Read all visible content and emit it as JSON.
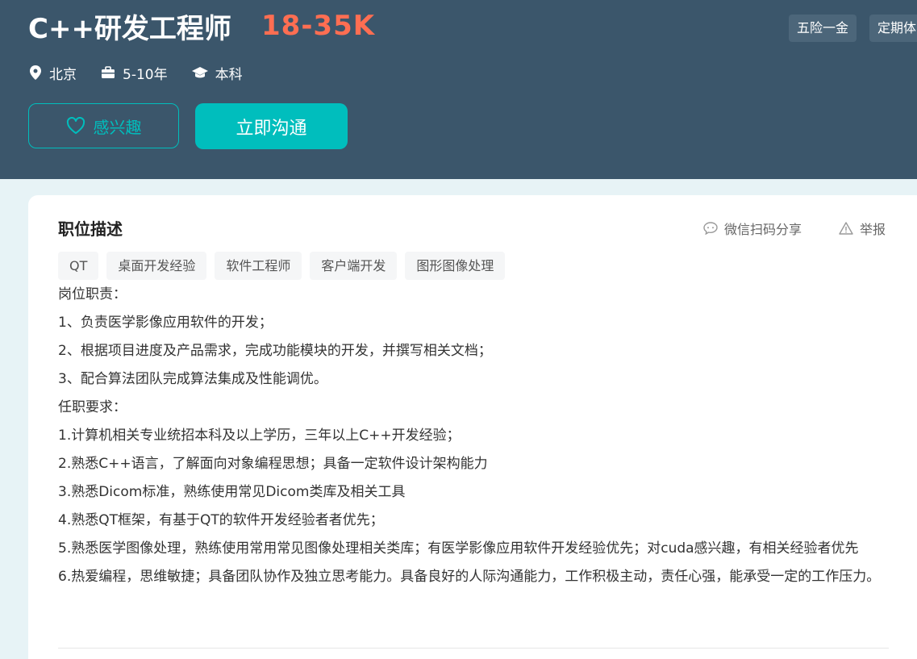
{
  "header": {
    "title": "C++研发工程师",
    "salary": "18-35K",
    "welfare": [
      "五险一金",
      "定期体"
    ],
    "meta": {
      "location": "北京",
      "experience": "5-10年",
      "degree": "本科"
    },
    "buttons": {
      "interest": "感兴趣",
      "chat": "立即沟通"
    }
  },
  "description": {
    "title": "职位描述",
    "share_label": "微信扫码分享",
    "report_label": "举报",
    "tags": [
      "QT",
      "桌面开发经验",
      "软件工程师",
      "客户端开发",
      "图形图像处理"
    ],
    "lines": [
      "岗位职责：",
      "1、负责医学影像应用软件的开发；",
      "2、根据项目进度及产品需求，完成功能模块的开发，并撰写相关文档；",
      "3、配合算法团队完成算法集成及性能调优。",
      "任职要求：",
      "1.计算机相关专业统招本科及以上学历，三年以上C++开发经验；",
      "2.熟悉C++语言，了解面向对象编程思想；具备一定软件设计架构能力",
      "3.熟悉Dicom标准，熟练使用常见Dicom类库及相关工具",
      "4.熟悉QT框架，有基于QT的软件开发经验者者优先；",
      "5.熟悉医学图像处理，熟练使用常用常见图像处理相关类库；有医学影像应用软件开发经验优先；对cuda感兴趣，有相关经验者优先",
      "6.热爱编程，思维敏捷；具备团队协作及独立思考能力。具备良好的人际沟通能力，工作积极主动，责任心强，能承受一定的工作压力。"
    ]
  },
  "colors": {
    "banner": "#3b566b",
    "accent": "#00bebd",
    "salary": "#fe6e52"
  }
}
